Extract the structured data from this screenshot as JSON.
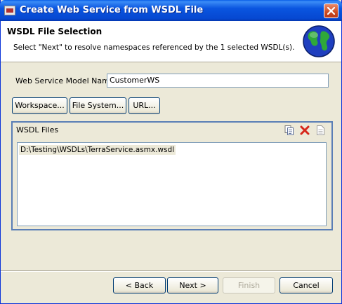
{
  "window": {
    "title": "Create Web Service from WSDL File"
  },
  "header": {
    "title": "WSDL File Selection",
    "description": "Select \"Next\" to resolve namespaces referenced by the 1 selected WSDL(s)."
  },
  "form": {
    "model_name_label": "Web Service Model Name",
    "model_name_value": "CustomerWS"
  },
  "source_buttons": {
    "workspace": "Workspace...",
    "file_system": "File System...",
    "url": "URL..."
  },
  "wsdl_files": {
    "title": "WSDL Files",
    "items": [
      "D:\\Testing\\WSDLs\\TerraService.asmx.wsdl"
    ]
  },
  "footer": {
    "back": "< Back",
    "next": "Next >",
    "finish": "Finish",
    "cancel": "Cancel"
  },
  "icons": {
    "app": "app-icon",
    "close": "close-icon",
    "globe": "globe-icon",
    "copy": "copy-icon",
    "delete": "delete-icon",
    "document": "document-icon"
  },
  "colors": {
    "titlebar": "#0a55e0",
    "dialog_bg": "#ece9d8",
    "group_border": "#5a7eb6",
    "delete_red": "#d6261a"
  }
}
